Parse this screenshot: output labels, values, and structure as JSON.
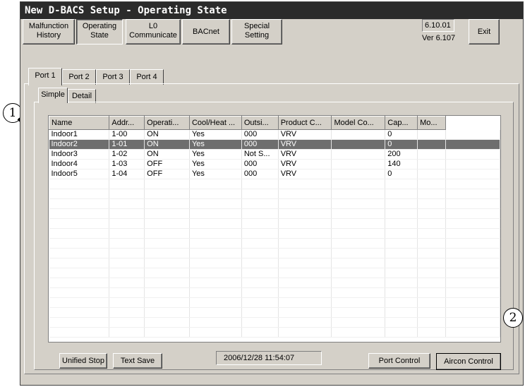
{
  "window": {
    "title": "New D-BACS Setup - Operating State"
  },
  "toolbar": {
    "malfunction_line1": "Malfunction",
    "malfunction_line2": "History",
    "operating_line1": "Operating",
    "operating_line2": "State",
    "lo_line1": "L0",
    "lo_line2": "Communicate",
    "bacnet": "BACnet",
    "special_line1": "Special",
    "special_line2": "Setting",
    "version_box": "6.10.01",
    "version_text": "Ver 6.107",
    "exit": "Exit"
  },
  "port_tabs": [
    "Port 1",
    "Port 2",
    "Port 3",
    "Port 4"
  ],
  "view_tabs": [
    "Simple",
    "Detail"
  ],
  "table": {
    "columns": [
      "Name",
      "Addr...",
      "Operati...",
      "Cool/Heat ...",
      "Outsi...",
      "Product C...",
      "Model Co...",
      "Cap...",
      "Mo..."
    ],
    "rows": [
      [
        "Indoor1",
        "1-00",
        "ON",
        "Yes",
        "000",
        "VRV",
        "",
        "0",
        ""
      ],
      [
        "Indoor2",
        "1-01",
        "ON",
        "Yes",
        "000",
        "VRV",
        "",
        "0",
        ""
      ],
      [
        "Indoor3",
        "1-02",
        "ON",
        "Yes",
        "Not S...",
        "VRV",
        "",
        "200",
        ""
      ],
      [
        "Indoor4",
        "1-03",
        "OFF",
        "Yes",
        "000",
        "VRV",
        "",
        "140",
        ""
      ],
      [
        "Indoor5",
        "1-04",
        "OFF",
        "Yes",
        "000",
        "VRV",
        "",
        "0",
        ""
      ]
    ],
    "selected_row": 1
  },
  "footer": {
    "unified_stop": "Unified Stop",
    "text_save": "Text Save",
    "datetime": "2006/12/28 11:54:07",
    "port_control": "Port Control",
    "aircon_control": "Aircon Control"
  },
  "callouts": {
    "one": "1",
    "two": "2"
  },
  "colors": {
    "titlebar": "#2b2b2b",
    "selection": "#6e6e6e",
    "face": "#d4d0c8"
  }
}
